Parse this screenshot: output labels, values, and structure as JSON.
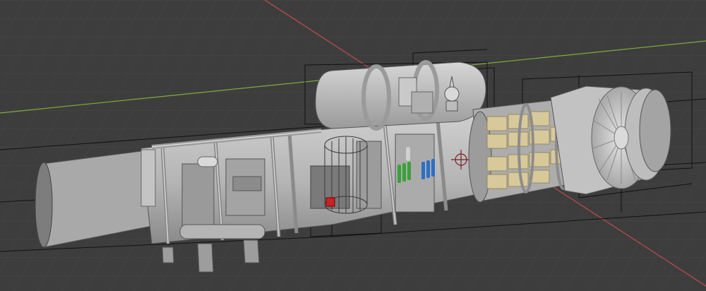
{
  "viewport": {
    "background": "#3d3d3d",
    "grid_color": "#474747",
    "x_axis_color": "#c94a4a",
    "y_axis_color": "#7fae3a"
  },
  "model": {
    "hull_color": "#b9b9b9",
    "hull_shadow": "#8d8d8d",
    "dark_panel": "#6c6c6c",
    "crate_color": "#d8c99a",
    "tank_green": "#3aa13a",
    "tank_blue": "#2c6fc7",
    "marker_red": "#cc2222",
    "wire_color": "#111111"
  }
}
